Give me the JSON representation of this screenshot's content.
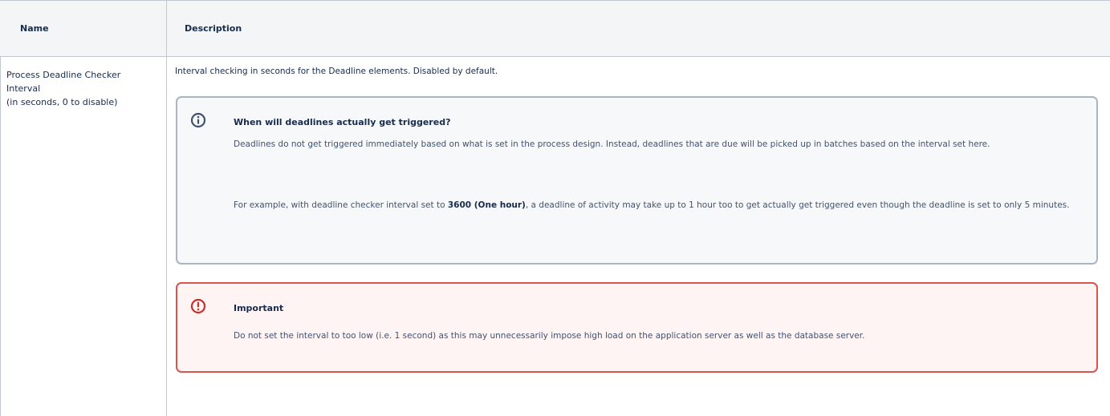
{
  "table": {
    "headers": {
      "name": "Name",
      "description": "Description"
    },
    "row": {
      "name_lines": [
        "Process Deadline Checker",
        "Interval",
        "(in seconds, 0 to disable)"
      ],
      "intro": "Interval checking in seconds for the Deadline elements. Disabled by default."
    }
  },
  "info_panel": {
    "icon": "info-icon",
    "title": "When will deadlines actually get triggered?",
    "para1": "Deadlines do not get triggered immediately based on what is set in the process design. Instead, deadlines that are due will be picked up in batches based on the interval set here.",
    "para2_before": "For example, with deadline checker interval set to ",
    "para2_bold": "3600 (One hour)",
    "para2_after": ", a deadline of activity may take up to 1 hour too to get actually get triggered even though the deadline is set to only 5 minutes."
  },
  "warning_panel": {
    "icon": "warning-icon",
    "title": "Important",
    "text": "Do not set the interval to too low (i.e. 1 second) as this may unnecessarily impose high load on the application server as well as the database server."
  },
  "colors": {
    "header_bg": "#f4f5f7",
    "border": "#c1c7d0",
    "info_border": "#aab4c2",
    "info_bg": "#f7f8f9",
    "warn_border": "#d9534f",
    "warn_bg": "#fff4f4",
    "info_icon": "#42526e",
    "warn_icon": "#c9302c"
  }
}
